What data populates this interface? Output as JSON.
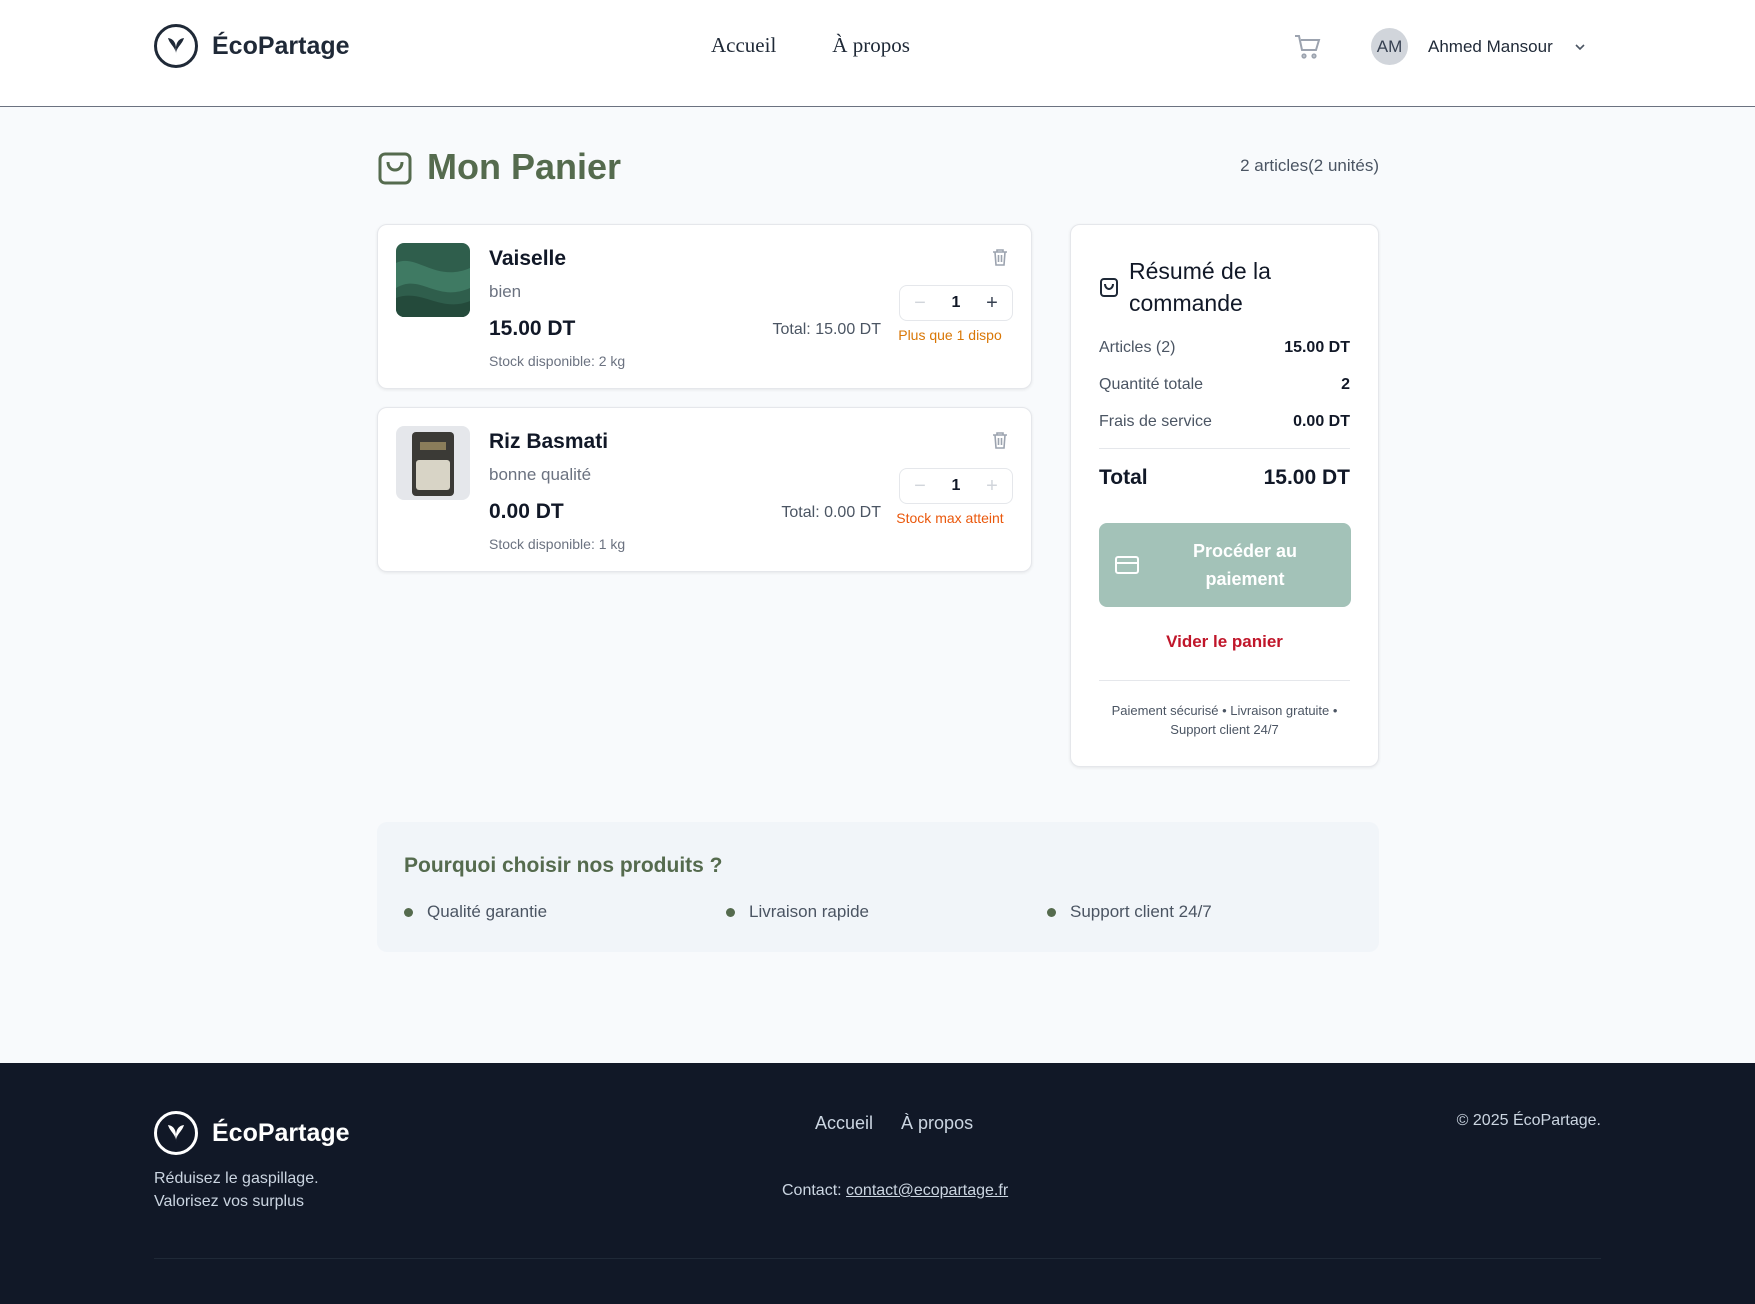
{
  "header": {
    "brand": "ÉcoPartage",
    "nav": [
      "Accueil",
      "À propos"
    ],
    "user_initials": "AM",
    "user_name": "Ahmed Mansour"
  },
  "cart": {
    "title": "Mon Panier",
    "count_label": "2 articles(2 unités)",
    "items": [
      {
        "name": "Vaiselle",
        "description": "bien",
        "price": "15.00 DT",
        "stock": "Stock disponible: 2 kg",
        "quantity": "1",
        "total": "Total: 15.00 DT",
        "stock_warning": "Plus que 1 dispo",
        "warning_color": "#d97706"
      },
      {
        "name": "Riz Basmati",
        "description": "bonne qualité",
        "price": "0.00 DT",
        "stock": "Stock disponible: 1 kg",
        "quantity": "1",
        "total": "Total: 0.00 DT",
        "stock_warning": "Stock max atteint",
        "warning_color": "#ea580c"
      }
    ]
  },
  "summary": {
    "title": "Résumé de la commande",
    "rows": [
      {
        "label": "Articles (2)",
        "value": "15.00 DT"
      },
      {
        "label": "Quantité totale",
        "value": "2"
      },
      {
        "label": "Frais de service",
        "value": "0.00 DT"
      }
    ],
    "total_label": "Total",
    "total_value": "15.00 DT",
    "pay_button": "Procéder au paiement",
    "clear_button": "Vider le panier",
    "note": "Paiement sécurisé • Livraison gratuite • Support client 24/7"
  },
  "why": {
    "title": "Pourquoi choisir nos produits ?",
    "items": [
      "Qualité garantie",
      "Livraison rapide",
      "Support client 24/7"
    ]
  },
  "footer": {
    "brand": "ÉcoPartage",
    "tagline": "Réduisez le gaspillage. Valorisez vos surplus",
    "nav": [
      "Accueil",
      "À propos"
    ],
    "contact_prefix": "Contact: ",
    "contact_email": "contact@ecopartage.fr",
    "copyright": "© 2025 ÉcoPartage."
  },
  "colors": {
    "accent": "#556b4e",
    "pay_button": "#a3c2b8",
    "danger": "#c0162a",
    "footer_bg": "#111827"
  }
}
